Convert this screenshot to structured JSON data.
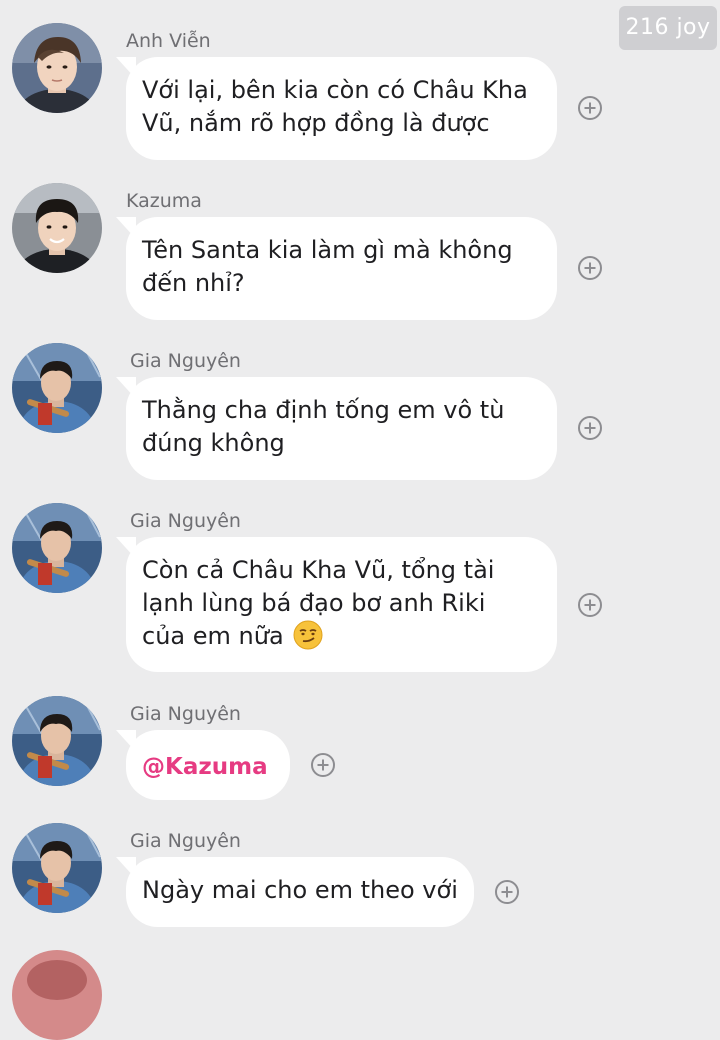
{
  "watermark": "216 joy",
  "messages": [
    {
      "sender": "Anh Viễn",
      "lines": [
        "Với lại, bên kia còn có Châu Kha",
        "Vũ, nắm rõ hợp đồng là được"
      ]
    },
    {
      "sender": "Kazuma",
      "lines": [
        "Tên Santa kia làm gì mà không",
        "đến nhỉ?"
      ]
    },
    {
      "sender": "Gia Nguyên",
      "lines": [
        "Thằng cha định tống em vô tù",
        "đúng không"
      ]
    },
    {
      "sender": "Gia Nguyên",
      "lines": [
        "Còn cả Châu Kha Vũ, tổng tài",
        "lạnh lùng bá đạo bơ anh Riki",
        "của em nữa"
      ],
      "emoji": "smirk-emoji"
    },
    {
      "sender": "Gia Nguyên",
      "mention": "@Kazuma"
    },
    {
      "sender": "Gia Nguyên",
      "lines": [
        "Ngày mai cho em theo với"
      ]
    }
  ],
  "icons": {
    "add_reaction": "plus-circle-icon"
  },
  "colors": {
    "background": "#ececed",
    "bubble": "#ffffff",
    "mention": "#e63b82",
    "sender_name": "#6f6f73"
  }
}
